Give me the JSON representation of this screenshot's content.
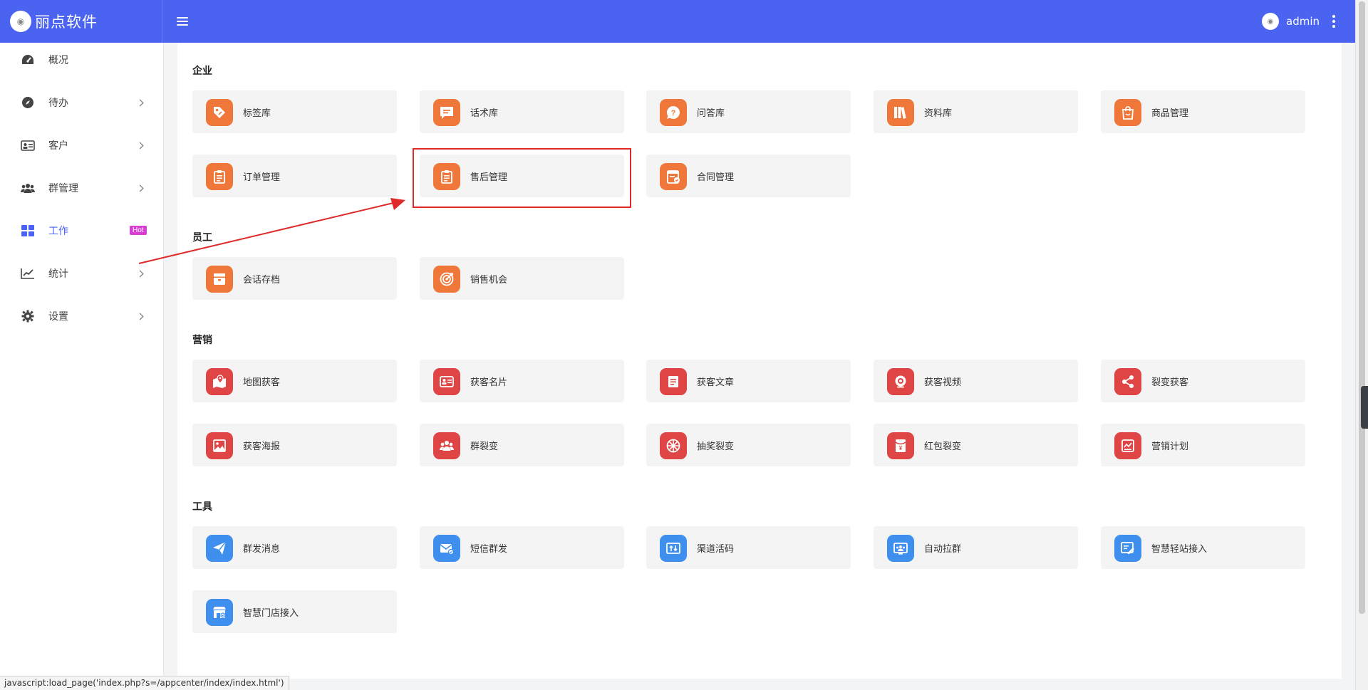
{
  "header": {
    "brand_name": "丽点软件",
    "logo_icon": "logo-icon",
    "username": "admin"
  },
  "sidebar": {
    "items": [
      {
        "label": "概况",
        "icon": "dashboard-icon"
      },
      {
        "label": "待办",
        "icon": "compass-icon"
      },
      {
        "label": "客户",
        "icon": "id-card-icon"
      },
      {
        "label": "群管理",
        "icon": "group-icon"
      },
      {
        "label": "工作",
        "icon": "grid-icon",
        "active": true,
        "badge": "Hot"
      },
      {
        "label": "统计",
        "icon": "chart-line-icon"
      },
      {
        "label": "设置",
        "icon": "gear-icon"
      }
    ]
  },
  "sections": {
    "enterprise": {
      "title": "企业",
      "cards": [
        "标签库",
        "话术库",
        "问答库",
        "资料库",
        "商品管理",
        "订单管理",
        "售后管理",
        "合同管理"
      ]
    },
    "staff": {
      "title": "员工",
      "cards": [
        "会话存档",
        "销售机会"
      ]
    },
    "marketing": {
      "title": "营销",
      "cards": [
        "地图获客",
        "获客名片",
        "获客文章",
        "获客视频",
        "裂变获客",
        "获客海报",
        "群裂变",
        "抽奖裂变",
        "红包裂变",
        "营销计划"
      ]
    },
    "tools": {
      "title": "工具",
      "cards": [
        "群发消息",
        "短信群发",
        "渠道活码",
        "自动拉群",
        "智慧轻站接入",
        "智慧门店接入"
      ]
    }
  },
  "colors": {
    "header_bg": "#4a63f0",
    "accent": "#4a63f0",
    "icon_orange": "#f0773a",
    "icon_red": "#e04545",
    "icon_blue": "#3e8fee",
    "hot_badge": "#d63fd1",
    "annotation_red": "#e02a2a"
  },
  "annotation": {
    "highlighted_card": "售后管理"
  },
  "status_bar": {
    "text": "javascript:load_page('index.php?s=/appcenter/index/index.html')"
  }
}
